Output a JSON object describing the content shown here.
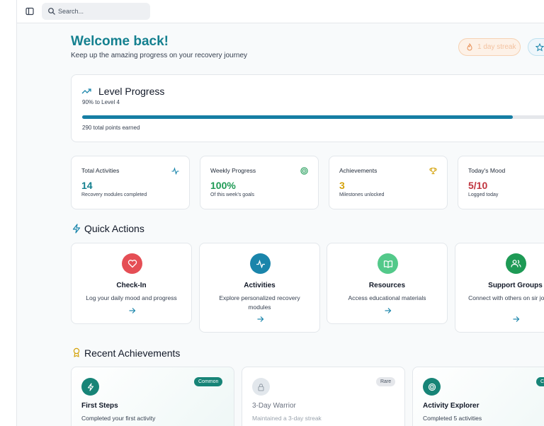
{
  "search": {
    "placeholder": "Search..."
  },
  "welcome": {
    "title": "Welcome back!",
    "subtitle": "Keep up the amazing progress on your recovery journey",
    "streak_label": "1 day streak"
  },
  "level": {
    "title": "Level Progress",
    "subtitle": "90% to Level 4",
    "progress_percent": 90,
    "points": "290 total points earned"
  },
  "stats": [
    {
      "label": "Total Activities",
      "value": "14",
      "desc": "Recovery modules completed",
      "color": "#14808f",
      "icon": "activity-icon"
    },
    {
      "label": "Weekly Progress",
      "value": "100%",
      "desc": "Of this week's goals",
      "color": "#1e9a55",
      "icon": "target-icon"
    },
    {
      "label": "Achievements",
      "value": "3",
      "desc": "Milestones unlocked",
      "color": "#d4a20a",
      "icon": "trophy-icon"
    },
    {
      "label": "Today's Mood",
      "value": "5/10",
      "desc": "Logged today",
      "color": "#c0353f",
      "icon": ""
    }
  ],
  "quick_actions": {
    "title": "Quick Actions",
    "items": [
      {
        "title": "Check-In",
        "desc": "Log your daily mood and progress",
        "color": "#e54e55",
        "icon": "heart-icon"
      },
      {
        "title": "Activities",
        "desc": "Explore personalized recovery modules",
        "color": "#1a85ab",
        "icon": "activity-icon"
      },
      {
        "title": "Resources",
        "desc": "Access educational materials",
        "color": "#53c98a",
        "icon": "book-icon"
      },
      {
        "title": "Support Groups",
        "desc": "Connect with others on sir journeys",
        "color": "#1e9a55",
        "icon": "users-icon"
      }
    ]
  },
  "achievements": {
    "title": "Recent Achievements",
    "items": [
      {
        "title": "First Steps",
        "desc": "Completed your first activity",
        "badge": "Common",
        "color": "#178477",
        "icon": "zap-icon"
      },
      {
        "title": "3-Day Warrior",
        "desc": "Maintained a 3-day streak",
        "badge": "Rare",
        "color": "#e2e7ec",
        "icon": "lock-icon"
      },
      {
        "title": "Activity Explorer",
        "desc": "Completed 5 activities",
        "badge": "C",
        "color": "#178477",
        "icon": "target-icon"
      }
    ]
  }
}
